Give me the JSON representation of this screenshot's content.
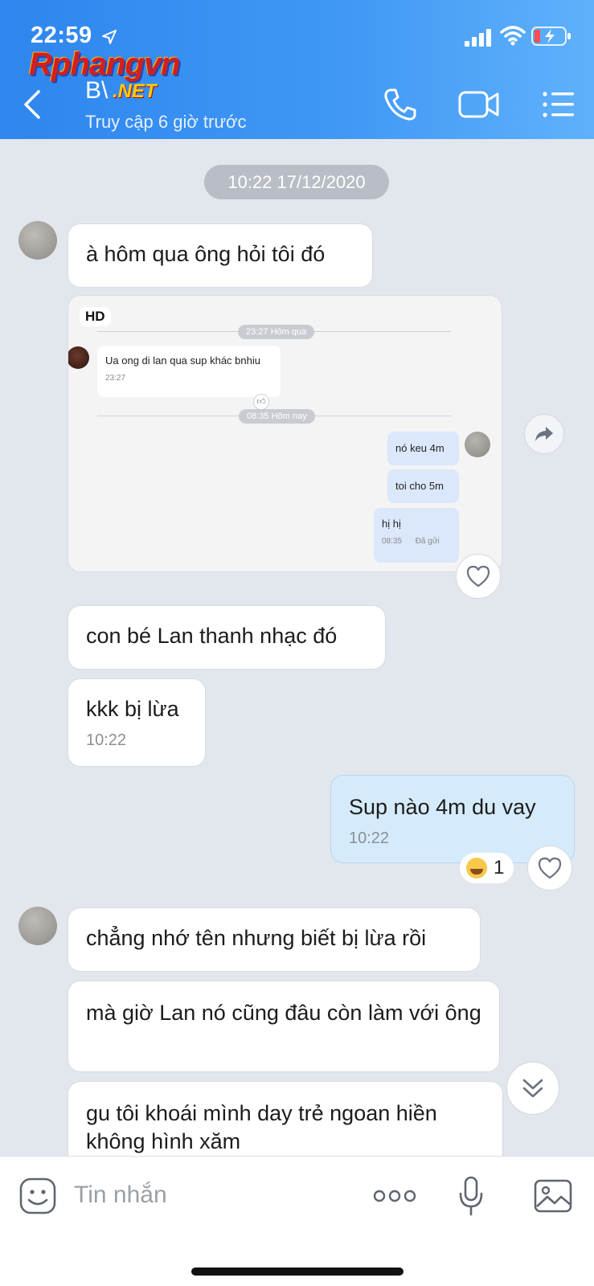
{
  "status_bar": {
    "time": "22:59",
    "icons": [
      "location-arrow-icon",
      "signal-icon",
      "wifi-icon",
      "battery-charging-icon"
    ]
  },
  "watermark": {
    "main": "Rphangvn",
    "suffix": ".NET"
  },
  "header": {
    "contact_name": "B\\",
    "last_seen": "Truy cập 6 giờ trước",
    "icons": [
      "back-chevron-icon",
      "phone-icon",
      "video-camera-icon",
      "list-menu-icon"
    ]
  },
  "chat": {
    "date_separator": "10:22 17/12/2020",
    "messages": [
      {
        "text": "à hôm qua ông hỏi tôi đó"
      },
      {
        "text": "con bé Lan thanh nhạc đó"
      },
      {
        "text": "kkk bị lừa",
        "time": "10:22"
      },
      {
        "text": "Sup nào 4m du vay",
        "time": "10:22",
        "mine": true,
        "reaction_count": "1"
      },
      {
        "text": "chẳng nhớ tên nhưng biết bị lừa rồi"
      },
      {
        "text": "mà giờ Lan nó cũng đâu còn làm với ông"
      },
      {
        "text": "gu tôi khoái mình day trẻ ngoan hiền không hình xăm"
      }
    ],
    "forwarded_image": {
      "badge": "HD",
      "divider1": "23:27 Hôm qua",
      "incoming": {
        "text": "Ua ong di lan qua sup khác bnhiu",
        "time": "23:27"
      },
      "divider2": "08:35 Hôm nay",
      "outgoing": [
        {
          "text": "nó keu 4m"
        },
        {
          "text": "toi cho 5m"
        },
        {
          "text": "hị hị",
          "time": "08:35",
          "status": "Đã gửi"
        }
      ]
    }
  },
  "input_bar": {
    "placeholder": "Tin nhắn"
  }
}
